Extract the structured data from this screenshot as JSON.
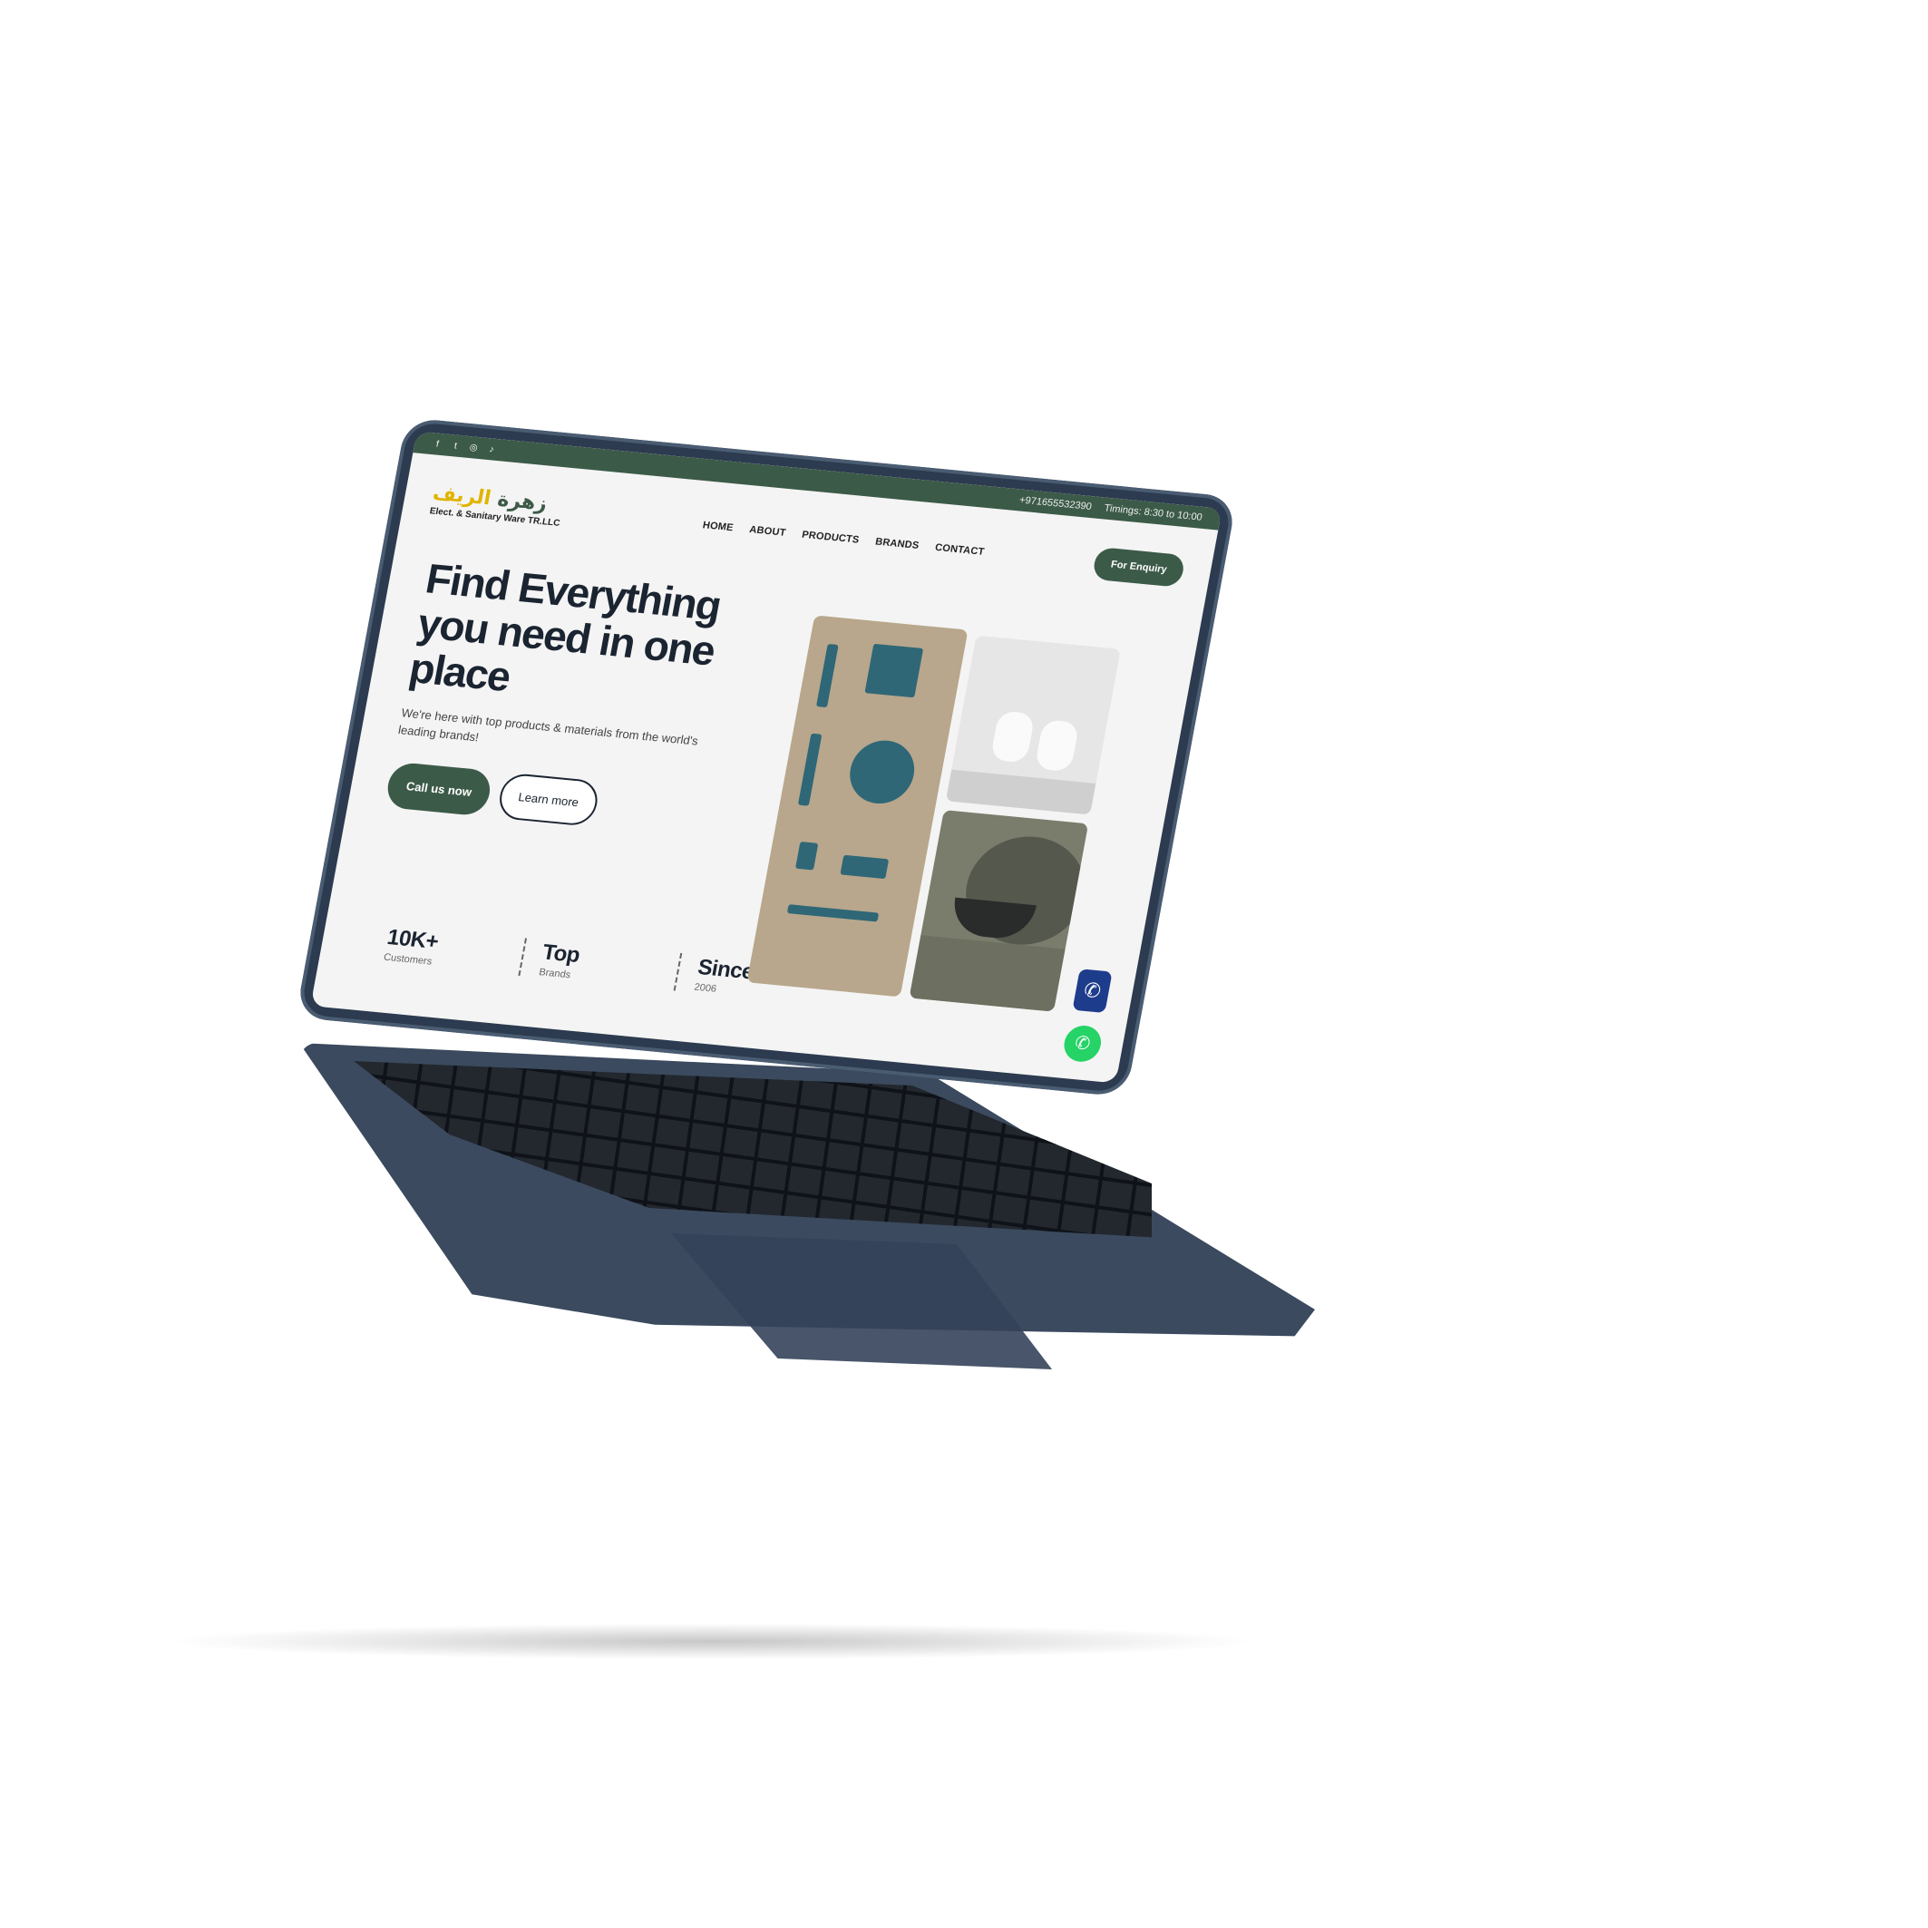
{
  "topbar": {
    "social_icons": [
      "facebook-icon",
      "twitter-icon",
      "instagram-icon",
      "tiktok-icon"
    ],
    "phone": "+971655532390",
    "timings": "Timings: 8:30 to 10:00"
  },
  "brand": {
    "arabic_part1": "زهرة",
    "arabic_part2": "الريف",
    "subtitle": "Elect. & Sanitary Ware TR.LLC"
  },
  "nav": {
    "items": [
      "HOME",
      "ABOUT",
      "PRODUCTS",
      "BRANDS",
      "CONTACT"
    ],
    "enquiry_label": "For Enquiry"
  },
  "hero": {
    "title_line1": "Find Everything",
    "title_line2": "you need in one place",
    "description": "We're here with top products & materials from the world's leading brands!",
    "primary_button": "Call us now",
    "secondary_button": "Learn more"
  },
  "stats": [
    {
      "big": "10K+",
      "small": "Customers"
    },
    {
      "big": "Top",
      "small": "Brands"
    },
    {
      "big": "Since",
      "small": "2006"
    }
  ],
  "colors": {
    "brand_green": "#3c5a48",
    "brand_gold": "#e0b400",
    "heading_dark": "#1b2431",
    "laptop_body": "#2c3b4f"
  },
  "floating_buttons": [
    "phone-icon",
    "whatsapp-icon"
  ]
}
